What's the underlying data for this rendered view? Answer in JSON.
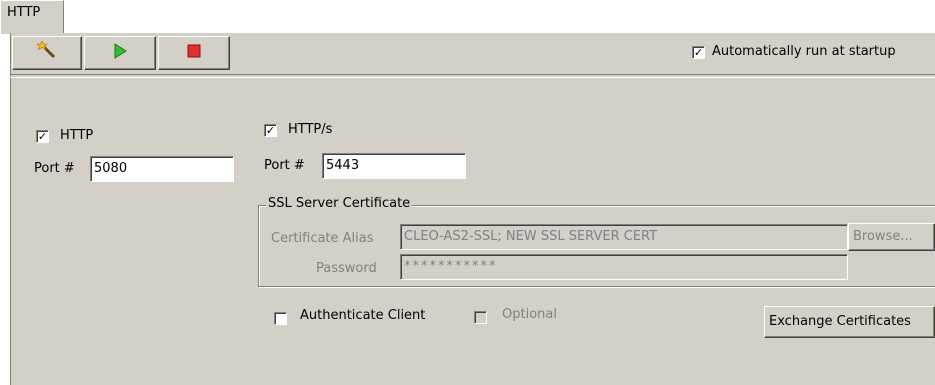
{
  "tab": {
    "label": "HTTP"
  },
  "toolbar": {
    "auto_run_label": "Automatically run at startup",
    "auto_run_checked": true
  },
  "http": {
    "label": "HTTP",
    "checked": true,
    "port_label": "Port #",
    "port_value": "5080"
  },
  "https": {
    "label": "HTTP/s",
    "checked": true,
    "port_label": "Port #",
    "port_value": "5443"
  },
  "ssl": {
    "group_title": "SSL Server Certificate",
    "alias_label": "Certificate Alias",
    "alias_value": "CLEO-AS2-SSL; NEW SSL SERVER CERT",
    "browse_label": "Browse...",
    "password_label": "Password",
    "password_value": "***********"
  },
  "client": {
    "authenticate_label": "Authenticate Client",
    "authenticate_checked": false,
    "optional_label": "Optional",
    "optional_checked": false,
    "exchange_label": "Exchange Certificates"
  },
  "colors": {
    "panel": "#d4d0c8",
    "play_green": "#2fbf2f",
    "stop_red": "#e03030"
  }
}
